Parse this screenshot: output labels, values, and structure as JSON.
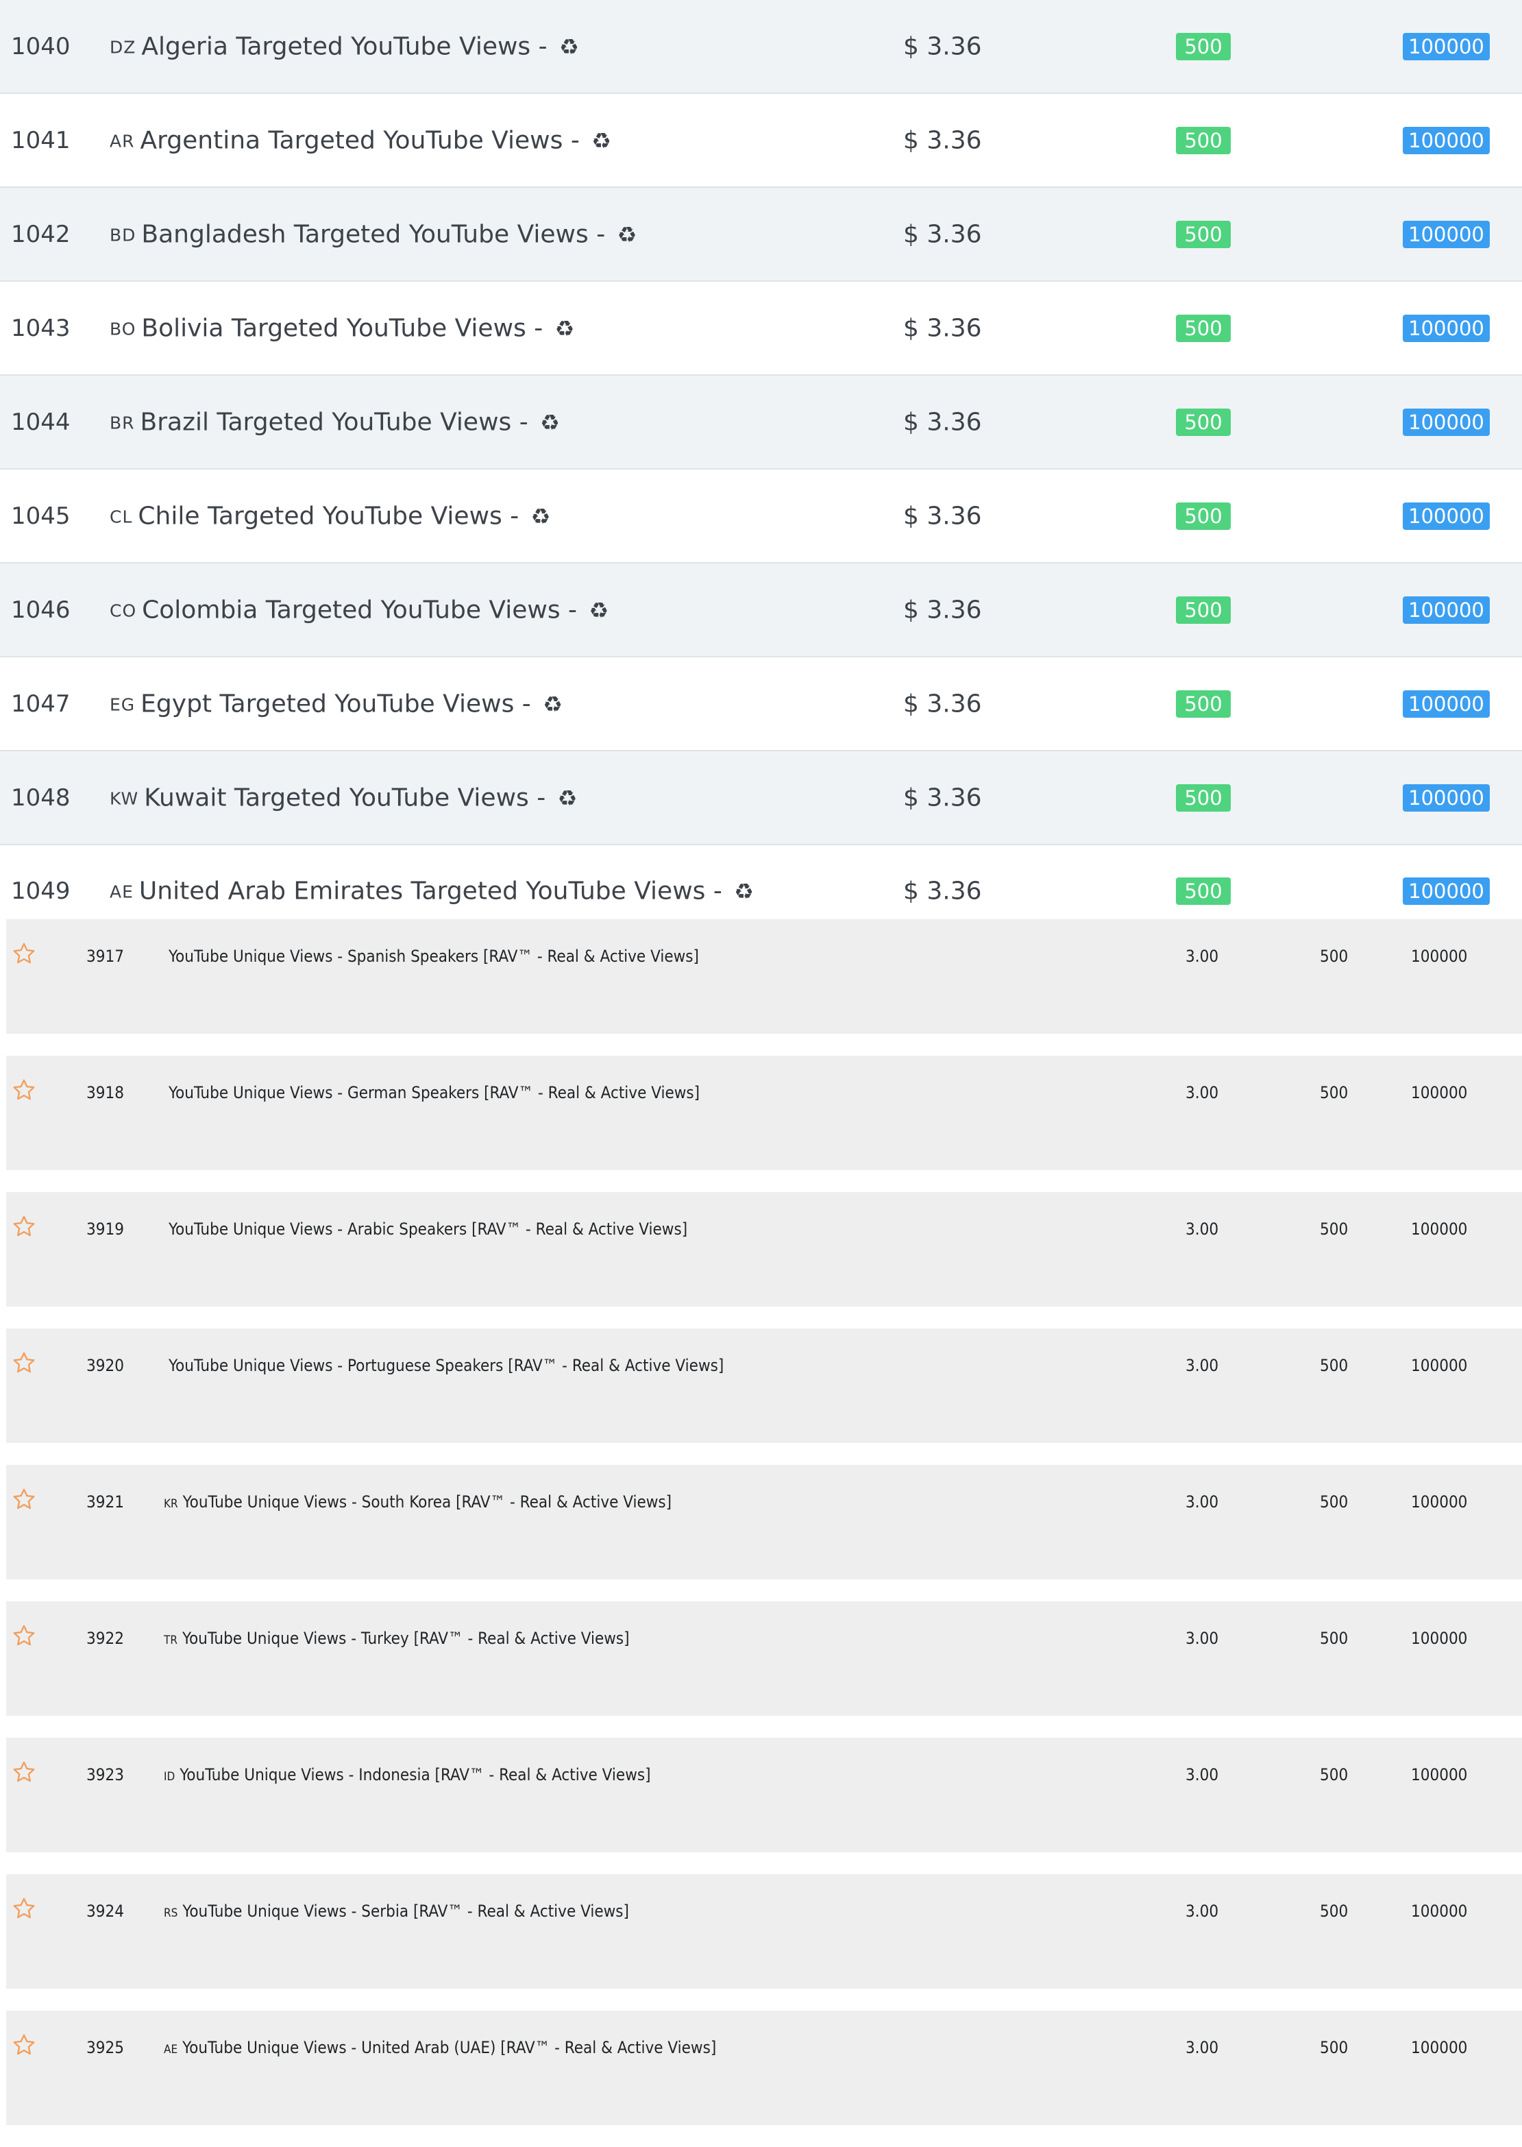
{
  "services_a": [
    {
      "id": "1040",
      "country_code": "DZ",
      "name": "Algeria Targeted YouTube Views -",
      "refill_icon": "♻",
      "price": "$ 3.36",
      "min": "500",
      "max": "100000"
    },
    {
      "id": "1041",
      "country_code": "AR",
      "name": "Argentina Targeted YouTube Views -",
      "refill_icon": "♻",
      "price": "$ 3.36",
      "min": "500",
      "max": "100000"
    },
    {
      "id": "1042",
      "country_code": "BD",
      "name": "Bangladesh Targeted YouTube Views -",
      "refill_icon": "♻",
      "price": "$ 3.36",
      "min": "500",
      "max": "100000"
    },
    {
      "id": "1043",
      "country_code": "BO",
      "name": "Bolivia Targeted YouTube Views -",
      "refill_icon": "♻",
      "price": "$ 3.36",
      "min": "500",
      "max": "100000"
    },
    {
      "id": "1044",
      "country_code": "BR",
      "name": "Brazil Targeted YouTube Views -",
      "refill_icon": "♻",
      "price": "$ 3.36",
      "min": "500",
      "max": "100000"
    },
    {
      "id": "1045",
      "country_code": "CL",
      "name": "Chile Targeted YouTube Views -",
      "refill_icon": "♻",
      "price": "$ 3.36",
      "min": "500",
      "max": "100000"
    },
    {
      "id": "1046",
      "country_code": "CO",
      "name": "Colombia Targeted YouTube Views -",
      "refill_icon": "♻",
      "price": "$ 3.36",
      "min": "500",
      "max": "100000"
    },
    {
      "id": "1047",
      "country_code": "EG",
      "name": "Egypt Targeted YouTube Views -",
      "refill_icon": "♻",
      "price": "$ 3.36",
      "min": "500",
      "max": "100000"
    },
    {
      "id": "1048",
      "country_code": "KW",
      "name": "Kuwait Targeted YouTube Views -",
      "refill_icon": "♻",
      "price": "$ 3.36",
      "min": "500",
      "max": "100000"
    },
    {
      "id": "1049",
      "country_code": "AE",
      "name": "United Arab Emirates Targeted YouTube Views -",
      "refill_icon": "♻",
      "price": "$ 3.36",
      "min": "500",
      "max": "100000"
    }
  ],
  "services_b": [
    {
      "id": "3917",
      "country_code": "",
      "name": "YouTube Unique Views - Spanish Speakers [RAV™ - Real & Active Views]",
      "rate": "3.00",
      "min": "500",
      "max": "100000"
    },
    {
      "id": "3918",
      "country_code": "",
      "name": "YouTube Unique Views - German Speakers [RAV™ - Real & Active Views]",
      "rate": "3.00",
      "min": "500",
      "max": "100000"
    },
    {
      "id": "3919",
      "country_code": "",
      "name": "YouTube Unique Views - Arabic Speakers [RAV™ - Real & Active Views]",
      "rate": "3.00",
      "min": "500",
      "max": "100000"
    },
    {
      "id": "3920",
      "country_code": "",
      "name": "YouTube Unique Views - Portuguese Speakers [RAV™ - Real & Active Views]",
      "rate": "3.00",
      "min": "500",
      "max": "100000"
    },
    {
      "id": "3921",
      "country_code": "KR",
      "name": "YouTube Unique Views - South Korea [RAV™ - Real & Active Views]",
      "rate": "3.00",
      "min": "500",
      "max": "100000"
    },
    {
      "id": "3922",
      "country_code": "TR",
      "name": "YouTube Unique Views - Turkey [RAV™ - Real & Active Views]",
      "rate": "3.00",
      "min": "500",
      "max": "100000"
    },
    {
      "id": "3923",
      "country_code": "ID",
      "name": "YouTube Unique Views - Indonesia [RAV™ - Real & Active Views]",
      "rate": "3.00",
      "min": "500",
      "max": "100000"
    },
    {
      "id": "3924",
      "country_code": "RS",
      "name": "YouTube Unique Views - Serbia [RAV™ - Real & Active Views]",
      "rate": "3.00",
      "min": "500",
      "max": "100000"
    },
    {
      "id": "3925",
      "country_code": "AE",
      "name": "YouTube Unique Views - United Arab (UAE) [RAV™ - Real & Active Views]",
      "rate": "3.00",
      "min": "500",
      "max": "100000"
    }
  ],
  "colors": {
    "min_badge": "#4fd37f",
    "max_badge": "#3b9ff1",
    "star_outline": "#f0a060",
    "row_shade_a": "#eff3f6",
    "row_shade_b": "#eeeeee"
  },
  "icons": {
    "refill": "recycle-icon",
    "favorite": "star-outline-icon"
  }
}
